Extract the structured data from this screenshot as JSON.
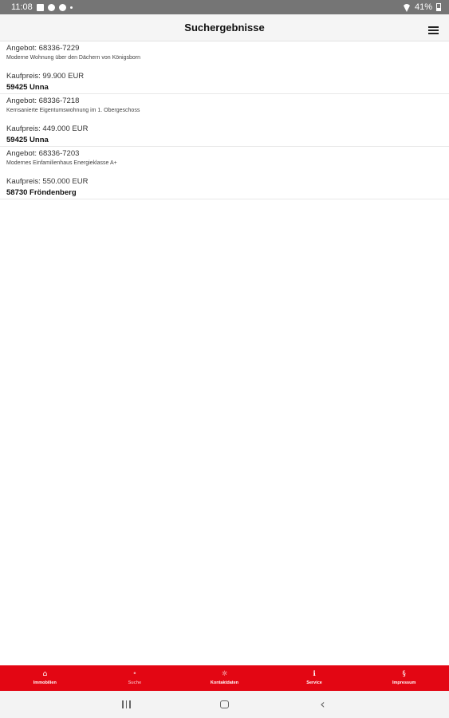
{
  "status_bar": {
    "time": "11:08",
    "battery": "41%"
  },
  "header": {
    "title": "Suchergebnisse",
    "menu_icon": "hamburger-menu-icon"
  },
  "results": [
    {
      "offer_id": "Angebot: 68336-7229",
      "description": "Moderne Wohnung über den Dächern von Königsborn",
      "price": "Kaufpreis: 99.900 EUR",
      "city": "59425 Unna"
    },
    {
      "offer_id": "Angebot: 68336-7218",
      "description": "Kernsanierte Eigentumswohnung im 1. Obergeschoss",
      "price": "Kaufpreis: 449.000 EUR",
      "city": "59425 Unna"
    },
    {
      "offer_id": "Angebot: 68336-7203",
      "description": "Modernes Einfamilienhaus Energieklasse A+",
      "price": "Kaufpreis: 550.000 EUR",
      "city": "58730 Fröndenberg"
    }
  ],
  "bottom_nav": {
    "items": [
      {
        "label": "Immobilien",
        "icon": "⌂",
        "icon_name": "house-icon"
      },
      {
        "label": "Suche",
        "icon": "•",
        "icon_name": "search-icon"
      },
      {
        "label": "Kontaktdaten",
        "icon": "☼",
        "icon_name": "contact-icon"
      },
      {
        "label": "Service",
        "icon": "ℹ",
        "icon_name": "info-icon"
      },
      {
        "label": "Impressum",
        "icon": "§",
        "icon_name": "sparkasse-icon"
      }
    ],
    "active_index": 1
  },
  "colors": {
    "accent": "#e30613",
    "status_bar": "#757575",
    "header_bg": "#f5f5f5"
  }
}
